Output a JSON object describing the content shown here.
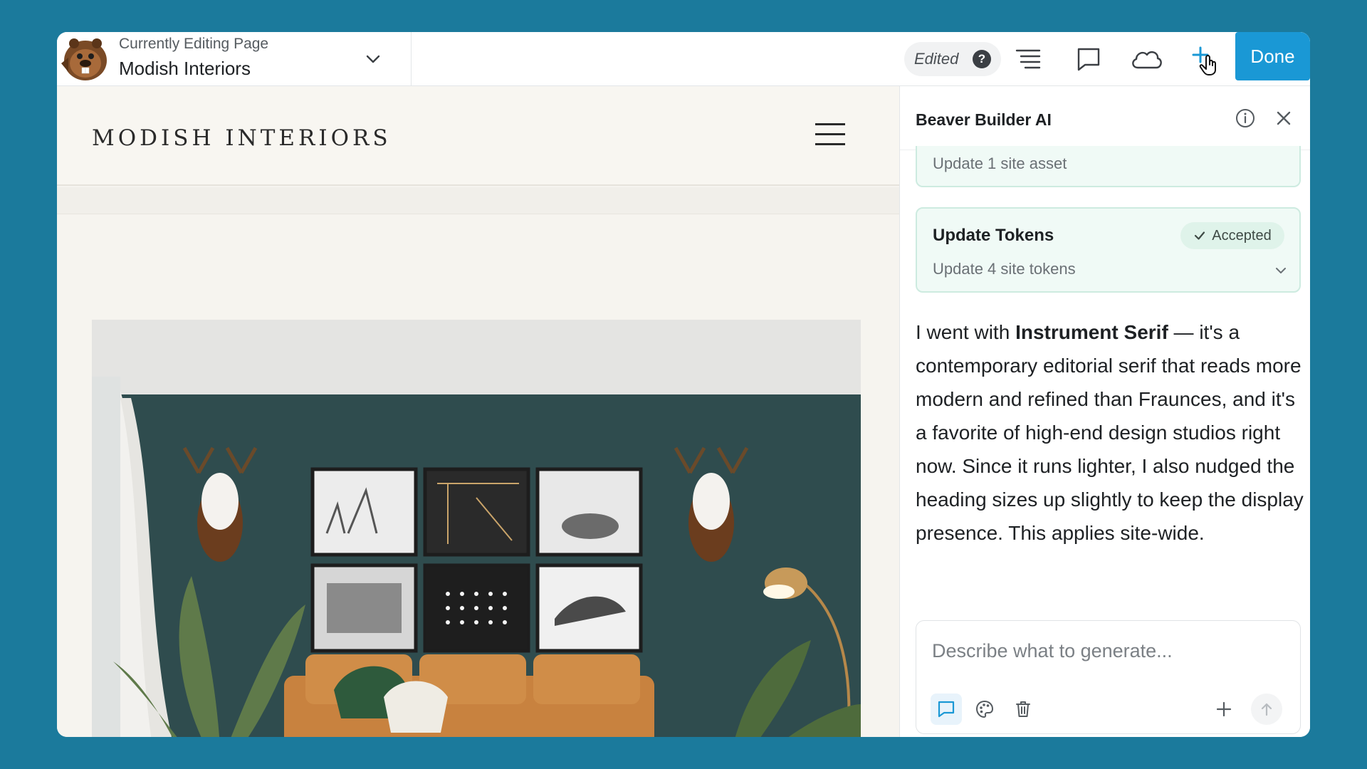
{
  "topbar": {
    "editing_caption": "Currently Editing Page",
    "page_name": "Modish Interiors",
    "status_label": "Edited",
    "status_help_glyph": "?",
    "done_label": "Done",
    "icons": [
      "outline-icon",
      "comment-icon",
      "cloud-icon",
      "add-icon"
    ]
  },
  "site": {
    "title": "MODISH INTERIORS"
  },
  "ai_panel": {
    "title": "Beaver Builder AI",
    "asset_card": {
      "text": "Update 1 site asset"
    },
    "tokens_card": {
      "title": "Update Tokens",
      "status": "Accepted",
      "subtitle": "Update 4 site tokens"
    },
    "message": {
      "before": "I went with ",
      "highlight": "Instrument Serif",
      "after": " — it's a contemporary editorial serif that reads more modern and refined than Fraunces, and it's a favorite of high-end design studios right now. Since it runs lighter, I also nudged the heading sizes up slightly to keep the display presence. This applies site-wide."
    },
    "composer": {
      "placeholder": "Describe what to generate..."
    }
  },
  "colors": {
    "background": "#1b7a9c",
    "accent": "#1a98d5",
    "success_bg": "#f0faf6",
    "wall": "#2f4c4e",
    "sofa": "#c8823f"
  }
}
